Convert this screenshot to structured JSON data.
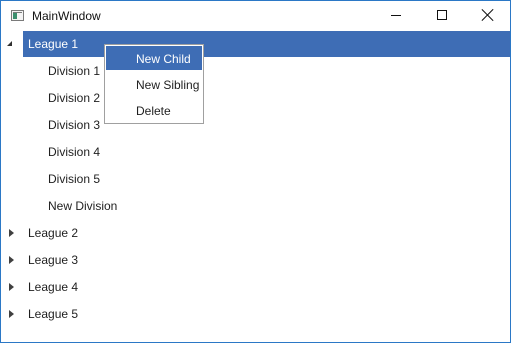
{
  "window": {
    "title": "MainWindow"
  },
  "tree": {
    "items": [
      {
        "label": "League 1",
        "expanded": true,
        "selected": true,
        "children": [
          "Division 1",
          "Division 2",
          "Division 3",
          "Division 4",
          "Division 5",
          "New Division"
        ]
      },
      {
        "label": "League 2",
        "expanded": false
      },
      {
        "label": "League 3",
        "expanded": false
      },
      {
        "label": "League 4",
        "expanded": false
      },
      {
        "label": "League 5",
        "expanded": false
      }
    ]
  },
  "context_menu": {
    "items": [
      {
        "label": "New Child",
        "highlighted": true
      },
      {
        "label": "New Sibling"
      },
      {
        "label": "Delete"
      }
    ]
  },
  "colors": {
    "selection": "#3e6db5",
    "window_border": "#2b78c6"
  }
}
